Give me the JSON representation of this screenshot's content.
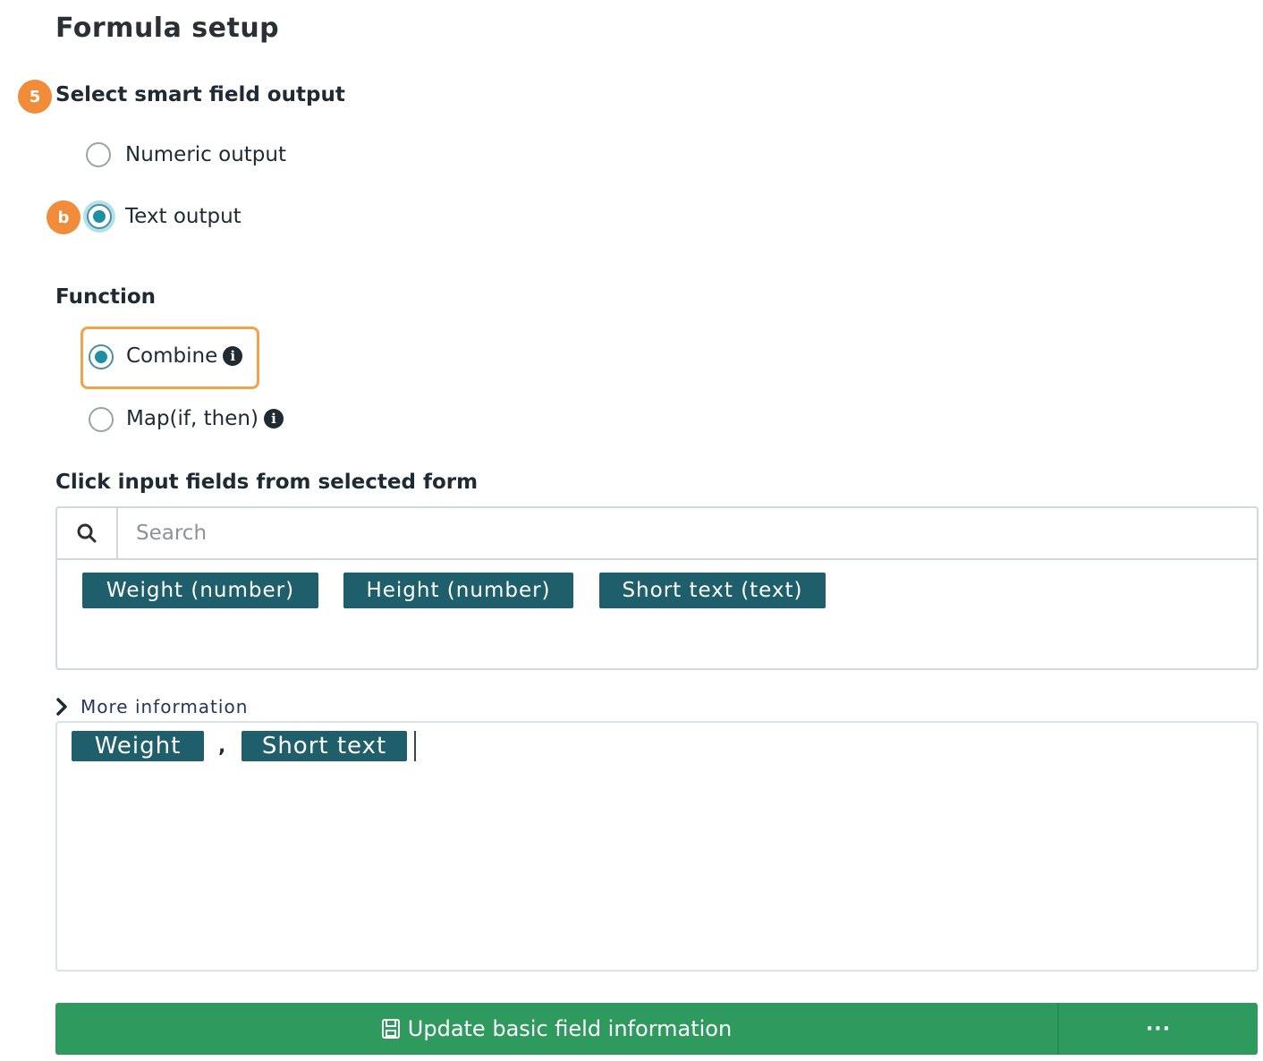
{
  "page": {
    "title": "Formula setup"
  },
  "output_section": {
    "step_badge": "5",
    "label": "Select smart field output",
    "options": [
      {
        "label": "Numeric output",
        "checked": false
      },
      {
        "label": "Text output",
        "checked": true
      }
    ],
    "option_badge": "b"
  },
  "function_section": {
    "label": "Function",
    "options": [
      {
        "label": "Combine",
        "checked": true,
        "info_icon": "info-icon"
      },
      {
        "label": "Map(if, then)",
        "checked": false,
        "info_icon": "info-icon"
      }
    ]
  },
  "input_fields_section": {
    "label": "Click input fields from selected form",
    "search": {
      "placeholder": "Search",
      "value": ""
    },
    "fields": [
      "Weight (number)",
      "Height (number)",
      "Short text (text)"
    ]
  },
  "more_information": {
    "label": "More information",
    "icon": "chevron-right-icon"
  },
  "formula": {
    "tokens": [
      "Weight",
      "Short text"
    ],
    "separator": ","
  },
  "actions": {
    "update_label": "Update basic field information",
    "update_icon": "save-icon",
    "more_label": "···"
  },
  "colors": {
    "accent_orange": "#f08c3a",
    "chip_teal": "#1f5f6b",
    "radio_teal": "#1e8fa0",
    "button_green": "#2e9a5e"
  }
}
